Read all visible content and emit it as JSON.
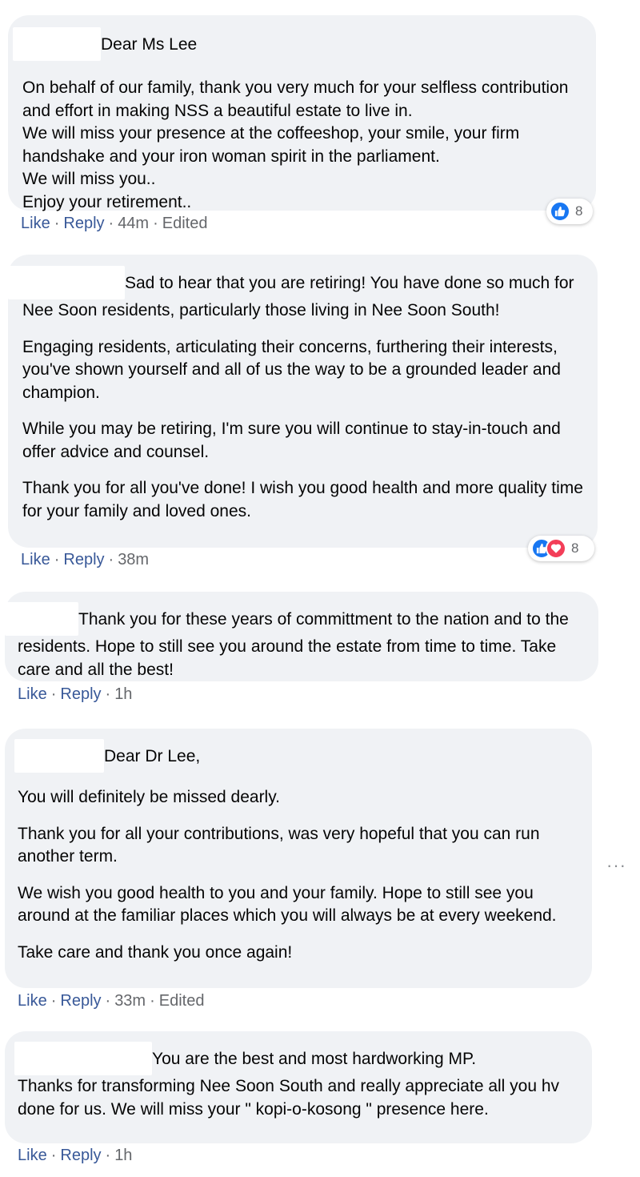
{
  "comments": [
    {
      "paragraphs": [
        "Dear Ms Lee",
        "On behalf of our family, thank you very much for your selfless contribution and effort in making NSS a beautiful estate to live in.\nWe will miss your presence at the coffeeshop, your smile, your firm handshake and your iron woman spirit in the parliament.\nWe will miss you..\nEnjoy your retirement.."
      ],
      "like": "Like",
      "reply": "Reply",
      "time": "44m",
      "edited": "Edited",
      "reaction_count": "8"
    },
    {
      "paragraphs": [
        "Sad to hear that you are retiring! You have done so much for Nee Soon residents, particularly those living in Nee Soon South!",
        "Engaging residents, articulating their concerns, furthering their interests, you've shown yourself and all of us the way to be a grounded leader and champion.",
        "While you may be retiring, I'm sure you will continue to stay-in-touch and offer advice and counsel.",
        "Thank you for all you've done! I wish you good health and more quality time for your family and loved ones."
      ],
      "like": "Like",
      "reply": "Reply",
      "time": "38m",
      "reaction_count": "8"
    },
    {
      "paragraphs": [
        "Thank you for these years of committment to the nation and to the residents. Hope to still see you around the estate from time to time. Take care and all the best!"
      ],
      "like": "Like",
      "reply": "Reply",
      "time": "1h"
    },
    {
      "paragraphs": [
        "Dear Dr Lee,",
        "You will definitely be missed dearly.",
        "Thank you for all your contributions, was very hopeful that you can run another term.",
        "We wish you good health to you and your family. Hope to still see you around at the familiar places which you will always be at every weekend.",
        "Take care and thank you once again!"
      ],
      "like": "Like",
      "reply": "Reply",
      "time": "33m",
      "edited": "Edited"
    },
    {
      "paragraphs": [
        "You are the best and most hardworking MP.\nThanks for transforming Nee Soon South and really appreciate all you hv done for us. We will miss your \" kopi-o-kosong \" presence here."
      ],
      "like": "Like",
      "reply": "Reply",
      "time": "1h"
    }
  ],
  "more_menu": "···",
  "colors": {
    "link": "#385898",
    "bubble": "#f0f2f5",
    "like_blue": "#1877f2",
    "love_red": "#f33e58"
  },
  "icons": [
    "like-reaction-icon",
    "love-reaction-icon",
    "more-options-icon"
  ]
}
